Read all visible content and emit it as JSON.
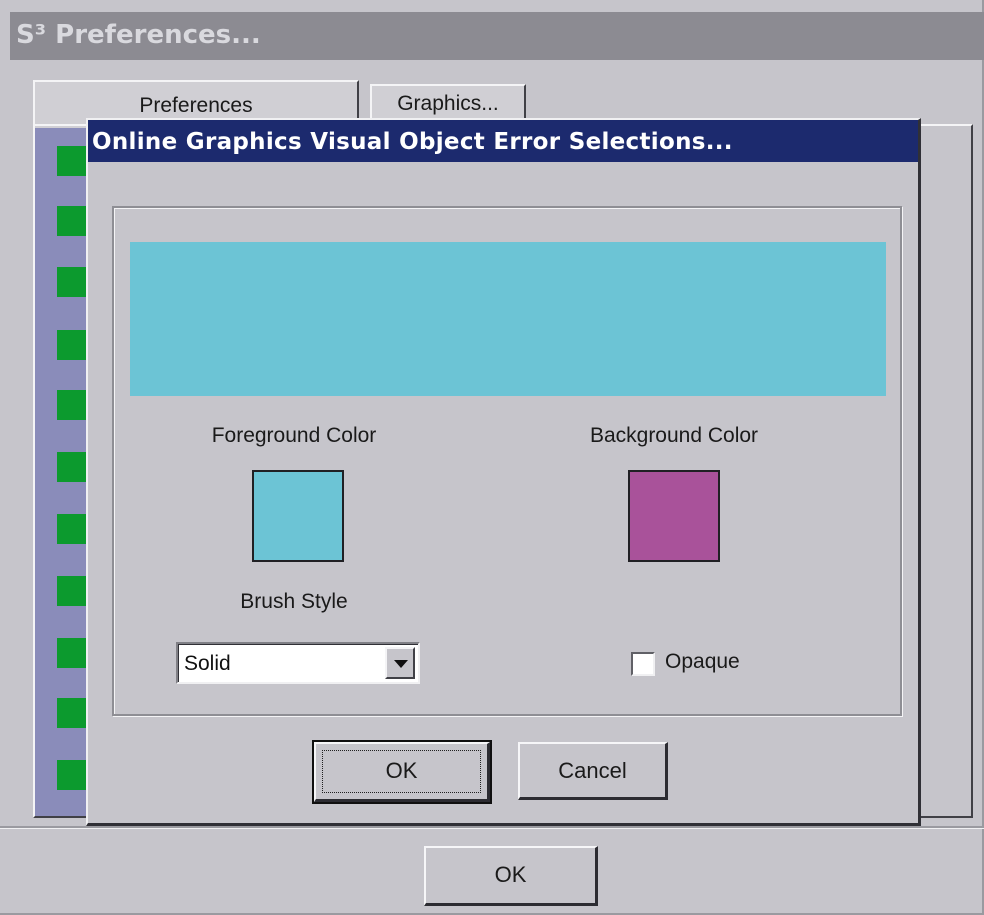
{
  "window": {
    "title": "S³ Preferences..."
  },
  "tabs": [
    {
      "label": "Preferences"
    },
    {
      "label": "Graphics..."
    }
  ],
  "dialog": {
    "title": "Online Graphics Visual Object Error Selections...",
    "preview_color": "#6cc4d5",
    "foreground": {
      "label": "Foreground Color",
      "color": "#6cc4d5"
    },
    "background": {
      "label": "Background Color",
      "color": "#a9529a"
    },
    "brush": {
      "label": "Brush Style",
      "value": "Solid"
    },
    "opaque": {
      "label": "Opaque",
      "checked": false
    },
    "ok_label": "OK",
    "cancel_label": "Cancel"
  },
  "footer": {
    "ok_label": "OK"
  },
  "colors": {
    "list_marker": "#0c9a2e",
    "title_bar": "#1c2a6e",
    "side_panel": "#8a8cba"
  }
}
